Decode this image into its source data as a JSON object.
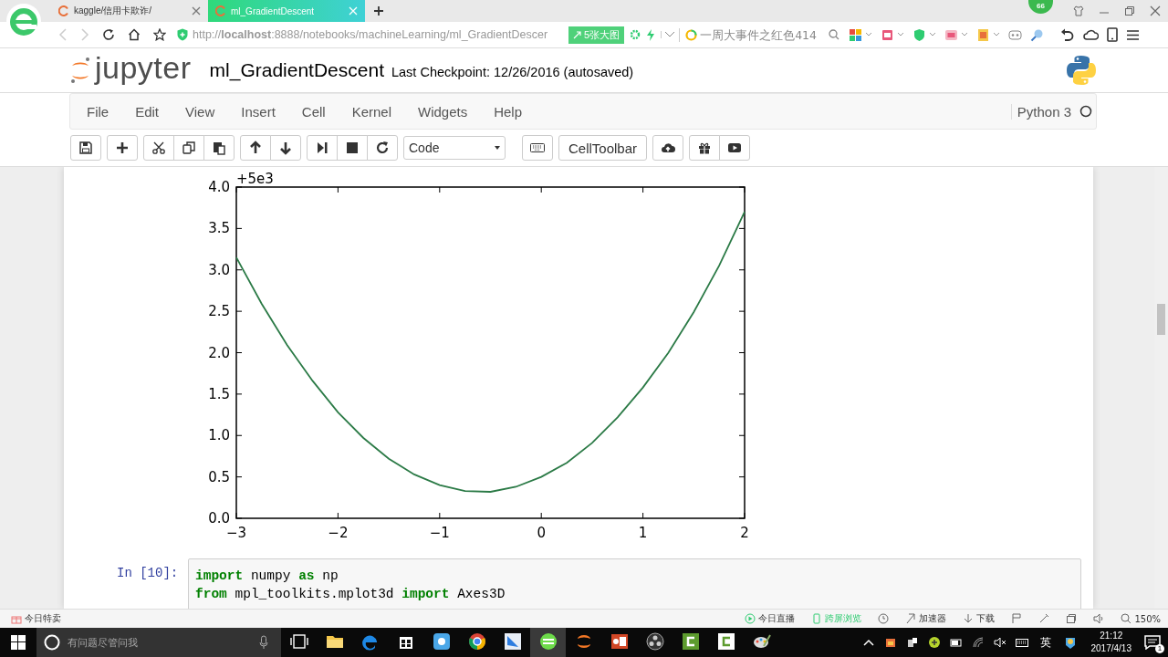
{
  "browser": {
    "tabs": [
      {
        "title": "kaggle/信用卡欺诈/",
        "selected": false
      },
      {
        "title": "ml_GradientDescent",
        "selected": true
      }
    ],
    "url": "http://**localhost**:8888/notebooks/machineLearning/ml_GradientDescer",
    "image_badge": "5张大图",
    "search_placeholder": "一周大事件之红色414",
    "account_badge": "66"
  },
  "notebook": {
    "logo": "jupyter",
    "name": "ml_GradientDescent",
    "checkpoint": "Last Checkpoint: 12/26/2016 (autosaved)",
    "menu": [
      "File",
      "Edit",
      "View",
      "Insert",
      "Cell",
      "Kernel",
      "Widgets",
      "Help"
    ],
    "kernel": {
      "name": "Python 3",
      "busy": false
    },
    "cell_type": "Code",
    "celltoolbar": "CellToolbar",
    "output": {
      "chart_data": {
        "type": "line",
        "x": [
          -3,
          -2.75,
          -2.5,
          -2.25,
          -2,
          -1.75,
          -1.5,
          -1.25,
          -1,
          -0.75,
          -0.5,
          -0.25,
          0,
          0.25,
          0.5,
          0.75,
          1,
          1.25,
          1.5,
          1.75,
          2
        ],
        "series": [
          {
            "color": "#2b7a46",
            "values": [
              3.15,
              2.59,
              2.09,
              1.66,
              1.28,
              0.97,
              0.72,
              0.53,
              0.4,
              0.33,
              0.32,
              0.38,
              0.5,
              0.67,
              0.91,
              1.22,
              1.58,
              2.0,
              2.49,
              3.05,
              3.7
            ]
          }
        ],
        "xlim": [
          -3,
          2
        ],
        "ylim": [
          0,
          4
        ],
        "xticks": [
          {
            "value": -3,
            "label": "−3"
          },
          {
            "value": -2,
            "label": "−2"
          },
          {
            "value": -1,
            "label": "−1"
          },
          0,
          1,
          2
        ],
        "yticks": [
          {
            "value": 0,
            "label": "0.0"
          },
          {
            "value": 0.5,
            "label": "0.5"
          },
          {
            "value": 1,
            "label": "1.0"
          },
          {
            "value": 1.5,
            "label": "1.5"
          },
          {
            "value": 2,
            "label": "2.0"
          },
          {
            "value": 2.5,
            "label": "2.5"
          },
          {
            "value": 3,
            "label": "3.0"
          },
          {
            "value": 3.5,
            "label": "3.5"
          },
          {
            "value": 4,
            "label": "4.0"
          }
        ],
        "annotations": [
          "+5e3"
        ]
      }
    },
    "code_cell": {
      "prompt": "In [10]:",
      "lines": [
        [
          {
            "text": "import",
            "kind": "keyword"
          },
          {
            "text": " numpy ",
            "kind": "plain"
          },
          {
            "text": "as",
            "kind": "keyword"
          },
          {
            "text": " np",
            "kind": "plain"
          }
        ],
        [
          {
            "text": "from",
            "kind": "keyword"
          },
          {
            "text": " mpl_toolkits.mplot3d ",
            "kind": "plain"
          },
          {
            "text": "import",
            "kind": "keyword"
          },
          {
            "text": " Axes3D",
            "kind": "plain"
          }
        ]
      ]
    }
  },
  "status_bar": {
    "left": "今日特卖",
    "items": [
      "今日直播",
      "跨屏浏览",
      "加速器",
      "下载"
    ],
    "zoom": "150%"
  },
  "taskbar": {
    "search_placeholder": "有问题尽管问我",
    "ime": "英",
    "time": "21:12",
    "date": "2017/4/13",
    "notifications": "1"
  }
}
